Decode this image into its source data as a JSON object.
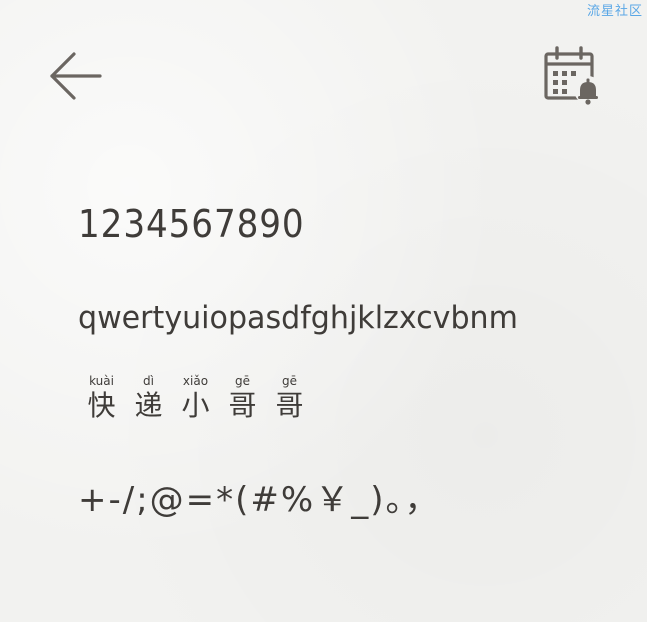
{
  "watermark": "流星社区",
  "header": {
    "back_icon": "arrow-left-icon",
    "calendar_icon": "calendar-bell-icon"
  },
  "sample": {
    "digits": "1234567890",
    "letters": "qwertyuiopasdfghjklzxcvbnm",
    "pinyin": [
      {
        "py": "kuài",
        "hz": "快"
      },
      {
        "py": "dì",
        "hz": "递"
      },
      {
        "py": "xiǎo",
        "hz": "小"
      },
      {
        "py": "gē",
        "hz": "哥"
      },
      {
        "py": "gē",
        "hz": "哥"
      }
    ],
    "symbols": "+-/;@=*(#%￥_)。，"
  },
  "colors": {
    "ink": "#3f3c39",
    "icon": "#6b6661",
    "watermark": "#5aa7e6",
    "paper": "#f2f2f0"
  }
}
